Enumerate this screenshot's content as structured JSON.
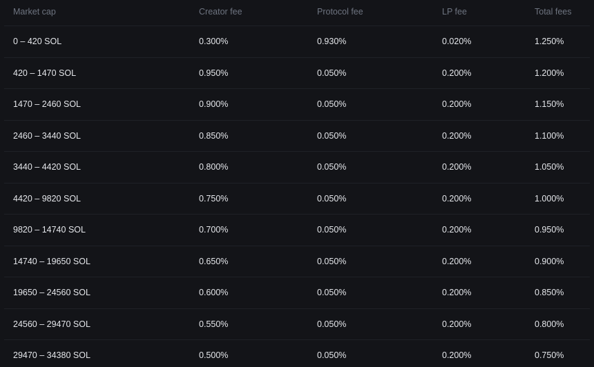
{
  "table": {
    "headers": [
      "Market cap",
      "Creator fee",
      "Protocol fee",
      "LP fee",
      "Total fees"
    ],
    "rows": [
      [
        "0 – 420 SOL",
        "0.300%",
        "0.930%",
        "0.020%",
        "1.250%"
      ],
      [
        "420 – 1470 SOL",
        "0.950%",
        "0.050%",
        "0.200%",
        "1.200%"
      ],
      [
        "1470 – 2460 SOL",
        "0.900%",
        "0.050%",
        "0.200%",
        "1.150%"
      ],
      [
        "2460 – 3440 SOL",
        "0.850%",
        "0.050%",
        "0.200%",
        "1.100%"
      ],
      [
        "3440 – 4420 SOL",
        "0.800%",
        "0.050%",
        "0.200%",
        "1.050%"
      ],
      [
        "4420 – 9820 SOL",
        "0.750%",
        "0.050%",
        "0.200%",
        "1.000%"
      ],
      [
        "9820 – 14740 SOL",
        "0.700%",
        "0.050%",
        "0.200%",
        "0.950%"
      ],
      [
        "14740 – 19650 SOL",
        "0.650%",
        "0.050%",
        "0.200%",
        "0.900%"
      ],
      [
        "19650 – 24560 SOL",
        "0.600%",
        "0.050%",
        "0.200%",
        "0.850%"
      ],
      [
        "24560 – 29470 SOL",
        "0.550%",
        "0.050%",
        "0.200%",
        "0.800%"
      ],
      [
        "29470 – 34380 SOL",
        "0.500%",
        "0.050%",
        "0.200%",
        "0.750%"
      ]
    ]
  }
}
